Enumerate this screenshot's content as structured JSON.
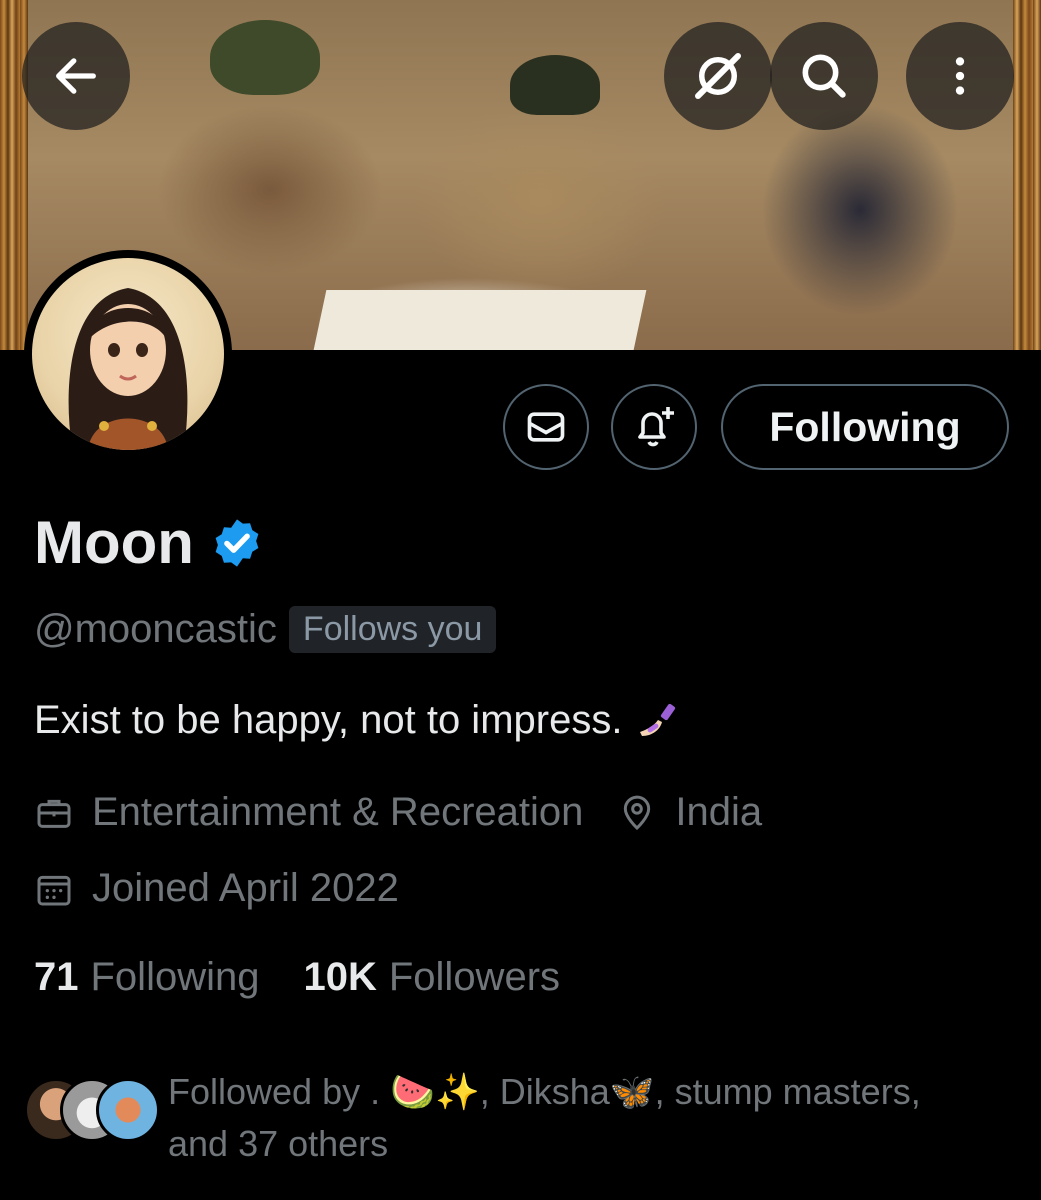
{
  "header": {
    "back_icon": "arrow-left-icon",
    "grok_icon": "grok-icon",
    "search_icon": "search-icon",
    "more_icon": "more-vertical-icon"
  },
  "profile": {
    "name": "Moon",
    "verified": true,
    "verified_color": "#1d9bf0",
    "handle": "@mooncastic",
    "follows_you": "Follows you",
    "bio": "Exist to be happy, not to impress.",
    "bio_emoji": "nail-polish-emoji",
    "category": "Entertainment & Recreation",
    "location": "India",
    "joined": "Joined April 2022"
  },
  "actions": {
    "message_icon": "mail-icon",
    "notify_icon": "bell-plus-icon",
    "follow_label": "Following"
  },
  "stats": {
    "following_count": "71",
    "following_label": "Following",
    "followers_count": "10K",
    "followers_label": "Followers"
  },
  "followed_by": {
    "prefix": "Followed by",
    "names": ". 🍉✨, Diksha🦋, stump masters,",
    "suffix": "and 37 others"
  },
  "colors": {
    "background": "#000000",
    "text_primary": "#e7e9ea",
    "text_secondary": "#71767b",
    "border": "#536471",
    "accent": "#1d9bf0"
  }
}
